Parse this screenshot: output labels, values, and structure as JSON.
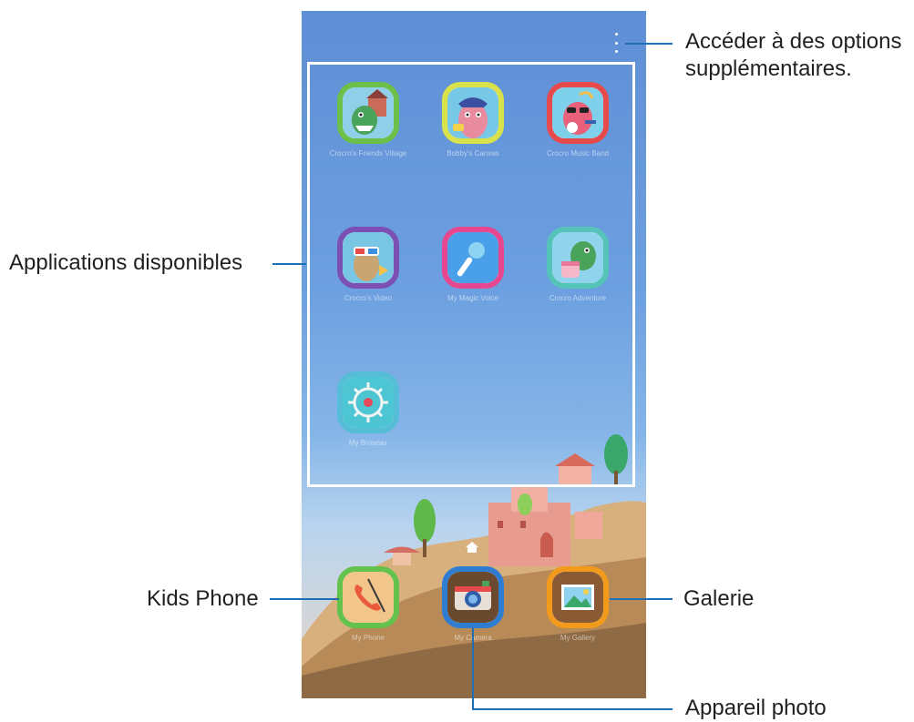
{
  "menu": {
    "icon": "more-options-icon"
  },
  "apps": [
    {
      "label": "Crocro's Friends Village",
      "icon": "dinosaur-village-icon",
      "ring": "#6cc04a"
    },
    {
      "label": "Bobby's Canvas",
      "icon": "bobby-canvas-icon",
      "ring": "#d9e24a"
    },
    {
      "label": "Crocro Music Band",
      "icon": "music-band-icon",
      "ring": "#e64a4a"
    },
    {
      "label": "Crocro's Video",
      "icon": "video-icon",
      "ring": "#7b4fb3"
    },
    {
      "label": "My Magic Voice",
      "icon": "microphone-icon",
      "ring": "#e6478f"
    },
    {
      "label": "Crocro Adventure",
      "icon": "dinosaur-adventure-icon",
      "ring": "#55c3b8"
    },
    {
      "label": "My Browser",
      "icon": "browser-wheel-icon",
      "ring": "#55bed6"
    }
  ],
  "dock": [
    {
      "label": "My Phone",
      "icon": "phone-icon",
      "ring": "#63c24b"
    },
    {
      "label": "My Camera",
      "icon": "camera-icon",
      "ring": "#2f7dd1"
    },
    {
      "label": "My Gallery",
      "icon": "gallery-icon",
      "ring": "#f29a1c"
    }
  ],
  "callouts": {
    "options_line1": "Accéder à des options",
    "options_line2": "supplémentaires.",
    "apps": "Applications disponibles",
    "kids_phone": "Kids Phone",
    "gallery": "Galerie",
    "camera": "Appareil photo"
  },
  "colors": {
    "callout_line": "#1f6fb4",
    "sky": "#6c9fe0"
  }
}
